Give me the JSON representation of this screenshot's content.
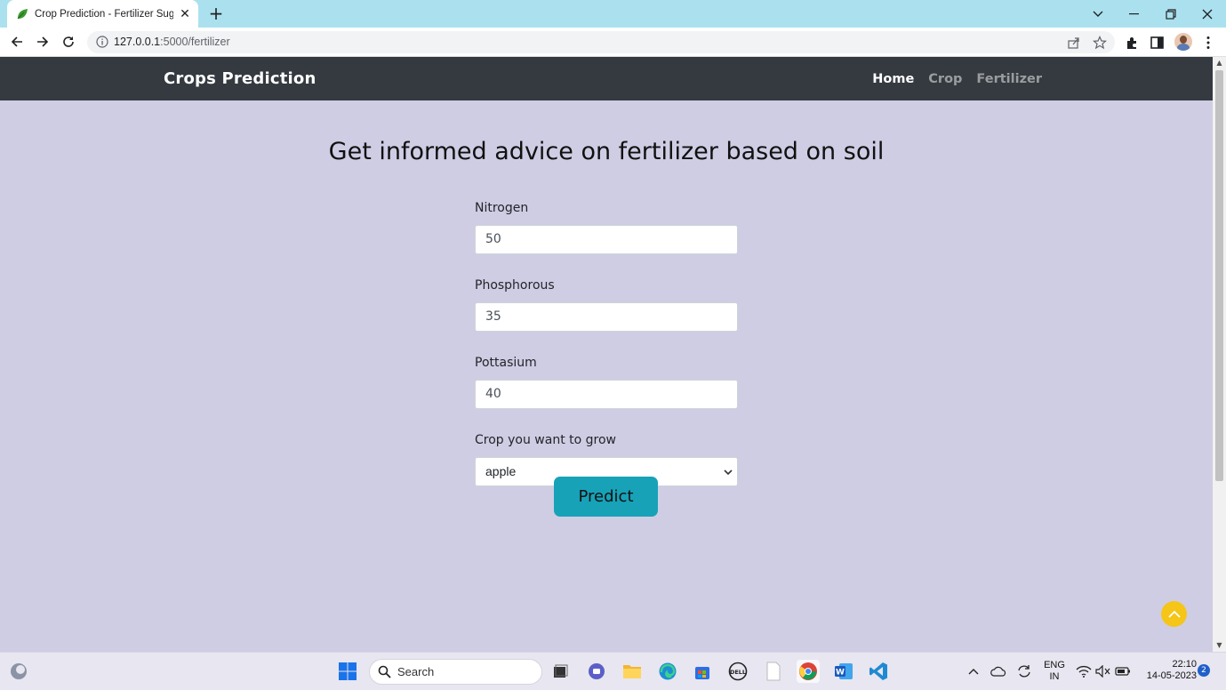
{
  "browser": {
    "tab_title": "Crop Prediction - Fertilizer Sugge",
    "url_host": "127.0.0.1",
    "url_path": ":5000/fertilizer"
  },
  "navbar": {
    "brand": "Crops Prediction",
    "links": [
      {
        "label": "Home",
        "active": true
      },
      {
        "label": "Crop",
        "active": false
      },
      {
        "label": "Fertilizer",
        "active": false
      }
    ]
  },
  "main": {
    "heading": "Get informed advice on fertilizer based on soil",
    "fields": [
      {
        "label": "Nitrogen",
        "value": "50"
      },
      {
        "label": "Phosphorous",
        "value": "35"
      },
      {
        "label": "Pottasium",
        "value": "40"
      }
    ],
    "crop_select": {
      "label": "Crop you want to grow",
      "selected": "apple"
    },
    "predict_label": "Predict"
  },
  "taskbar": {
    "search_label": "Search",
    "language": "ENG",
    "region": "IN",
    "time": "22:10",
    "date": "14-05-2023",
    "notification_count": "2"
  },
  "colors": {
    "page_bg": "#cfcde4",
    "navbar_bg": "#343a40",
    "button": "#17a2b8",
    "scrollup": "#f5c518"
  }
}
